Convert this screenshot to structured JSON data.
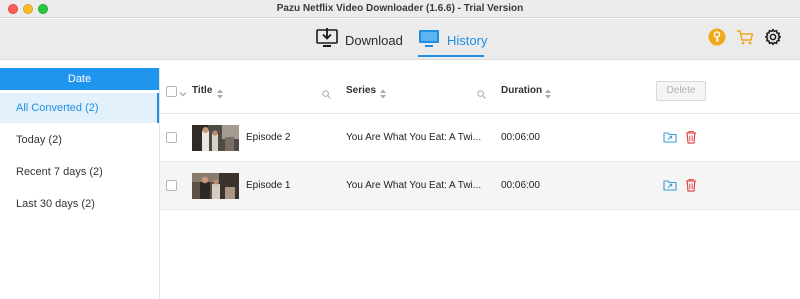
{
  "window": {
    "title": "Pazu Netflix Video Downloader (1.6.6) - Trial Version"
  },
  "toolbar": {
    "tabs": [
      {
        "label": "Download",
        "icon": "download-monitor-icon"
      },
      {
        "label": "History",
        "icon": "monitor-icon",
        "active": true
      }
    ],
    "buttons": [
      {
        "icon": "key-icon",
        "color": "#f0a020"
      },
      {
        "icon": "cart-icon",
        "color": "#f0a020"
      },
      {
        "icon": "gear-icon",
        "color": "#222222"
      }
    ]
  },
  "sidebar": {
    "header": "Date",
    "items": [
      {
        "label": "All Converted (2)",
        "active": true
      },
      {
        "label": "Today (2)"
      },
      {
        "label": "Recent 7 days (2)"
      },
      {
        "label": "Last 30 days (2)"
      }
    ]
  },
  "table": {
    "columns": {
      "title": "Title",
      "series": "Series",
      "duration": "Duration"
    },
    "delete_label": "Delete",
    "rows": [
      {
        "title": "Episode 2",
        "series": "You Are What You Eat: A Twi...",
        "duration": "00:06:00"
      },
      {
        "title": "Episode 1",
        "series": "You Are What You Eat: A Twi...",
        "duration": "00:06:00"
      }
    ]
  },
  "colors": {
    "accent": "#1f95ee",
    "delete_icon": "#e04848",
    "folder_icon": "#3a9ad9"
  }
}
